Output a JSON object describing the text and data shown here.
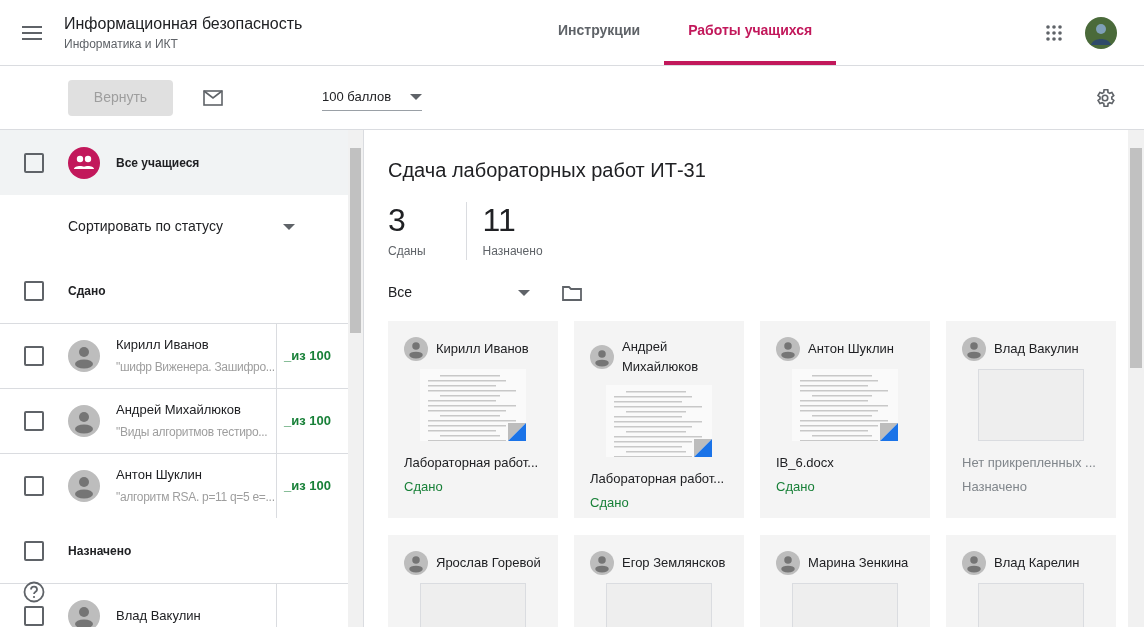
{
  "header": {
    "title": "Информационная безопасность",
    "subtitle": "Информатика и ИКТ",
    "tabs": [
      {
        "label": "Инструкции",
        "selected": false
      },
      {
        "label": "Работы учащихся",
        "selected": true
      }
    ]
  },
  "toolbar": {
    "return_button": {
      "label": "Вернуть",
      "disabled": true
    },
    "points": "100 баллов"
  },
  "left_panel": {
    "all_students": {
      "label": "Все учащиеся",
      "checked": false
    },
    "sort": "Сортировать по статусу",
    "groups": [
      {
        "label": "Сдано",
        "checked": false,
        "students": [
          {
            "name": "Кирилл Иванов",
            "note": "\"шифр Виженера. Зашифро...",
            "grade": "_из 100",
            "checked": false
          },
          {
            "name": "Андрей Михайлюков",
            "note": "\"Виды алгоритмов тестиро...",
            "grade": "_из 100",
            "checked": false
          },
          {
            "name": "Антон Шуклин",
            "note": "\"алгоритм RSA. p=11 q=5 e=...",
            "grade": "_из 100",
            "checked": false
          }
        ]
      },
      {
        "label": "Назначено",
        "checked": false,
        "students": [
          {
            "name": "Влад Вакулин",
            "checked": false
          }
        ]
      }
    ]
  },
  "main": {
    "title": "Сдача лабораторных работ ИТ-31",
    "stats": [
      {
        "value": "3",
        "label": "Сданы"
      },
      {
        "value": "11",
        "label": "Назначено"
      }
    ],
    "filter": "Все",
    "cards": [
      {
        "name": "Кирилл Иванов",
        "kind": "document",
        "attachment": "Лабораторная работ...",
        "status": "Сдано",
        "submitted": true
      },
      {
        "name": "Андрей Михайлюков",
        "kind": "document",
        "attachment": "Лабораторная работ...",
        "status": "Сдано",
        "submitted": true
      },
      {
        "name": "Антон Шуклин",
        "kind": "document",
        "attachment": "IB_6.docx",
        "status": "Сдано",
        "submitted": true
      },
      {
        "name": "Влад Вакулин",
        "kind": "empty",
        "attachment": "Нет прикрепленных ...",
        "status": "Назначено",
        "submitted": false
      },
      {
        "name": "Ярослав Горевой",
        "kind": "empty"
      },
      {
        "name": "Егор Землянсков",
        "kind": "empty"
      },
      {
        "name": "Марина Зенкина",
        "kind": "empty"
      },
      {
        "name": "Влад Карелин",
        "kind": "empty"
      }
    ]
  }
}
